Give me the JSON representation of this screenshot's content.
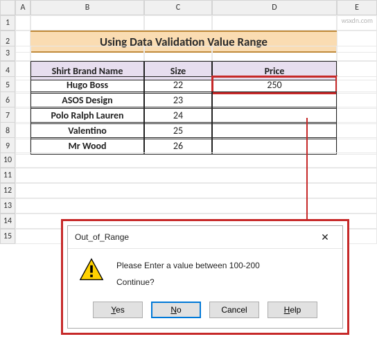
{
  "columns": [
    "A",
    "B",
    "C",
    "D",
    "E"
  ],
  "rows": [
    "1",
    "2",
    "3",
    "4",
    "5",
    "6",
    "7",
    "8",
    "9",
    "10",
    "11",
    "12",
    "13",
    "14",
    "15"
  ],
  "title": "Using Data Validation Value Range",
  "table": {
    "headers": {
      "brand": "Shirt Brand Name",
      "size": "Size",
      "price": "Price"
    },
    "rows": [
      {
        "brand": "Hugo Boss",
        "size": "22",
        "price": "250"
      },
      {
        "brand": "ASOS Design",
        "size": "23",
        "price": ""
      },
      {
        "brand": "Polo Ralph Lauren",
        "size": "24",
        "price": ""
      },
      {
        "brand": "Valentino",
        "size": "25",
        "price": ""
      },
      {
        "brand": "Mr Wood",
        "size": "26",
        "price": ""
      }
    ]
  },
  "dialog": {
    "title": "Out_of_Range",
    "message": "Please Enter a value between 100-200",
    "continue": "Continue?",
    "buttons": {
      "yes": "Yes",
      "no": "No",
      "cancel": "Cancel",
      "help": "Help"
    }
  },
  "watermark": "wsxdn.com"
}
